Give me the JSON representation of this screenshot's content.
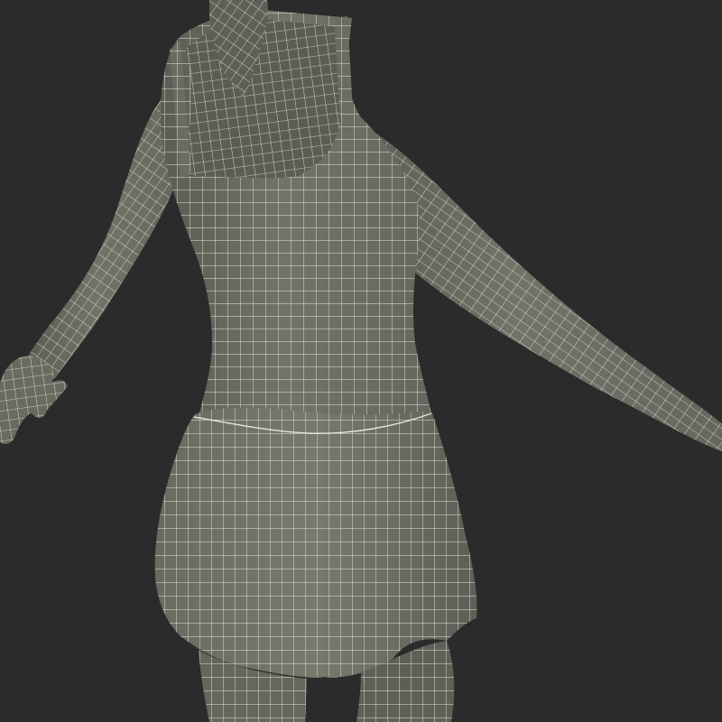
{
  "scene": {
    "description_visible_text": [],
    "colors": {
      "background": "#2b2b2b",
      "mesh_fill": "#6e6e64",
      "mesh_fill_shadow": "#5a5a52",
      "mesh_fill_light": "#7d7d72",
      "wire": "#e6e6d8",
      "hair": "#5f5f57"
    },
    "render_style": "wireframe-on-shaded",
    "subject_icon": "human-figure-dress-wireframe"
  }
}
